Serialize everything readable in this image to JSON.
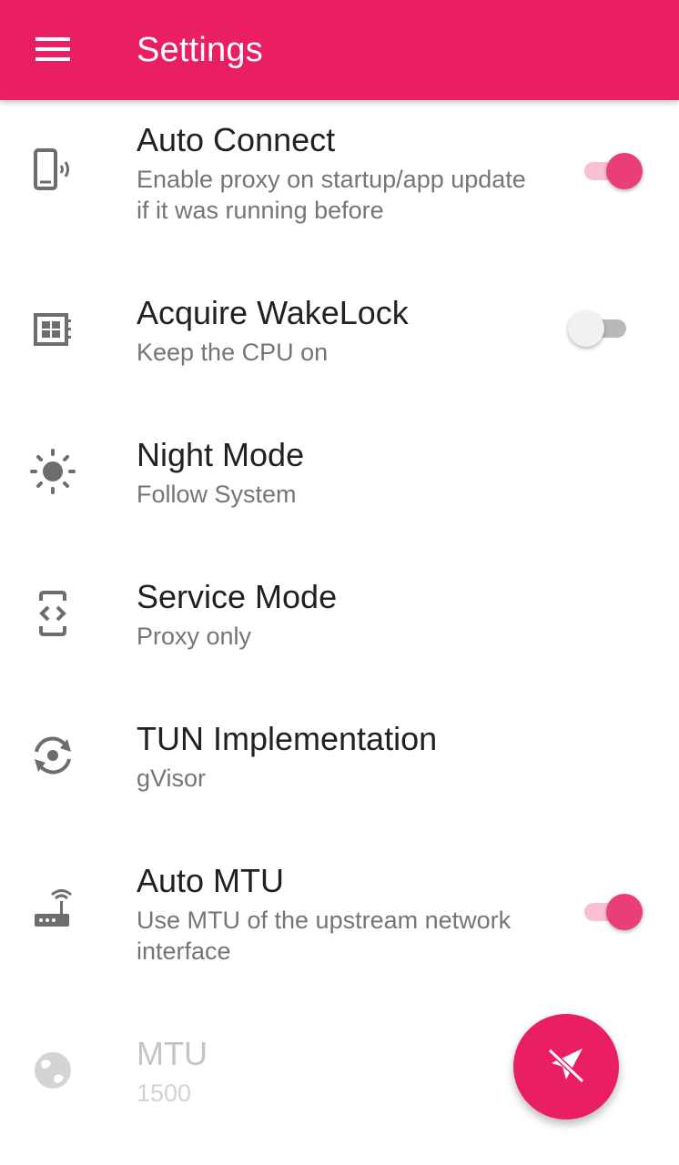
{
  "appbar": {
    "title": "Settings",
    "menu_icon": "menu-icon",
    "color": "#ea1e63"
  },
  "preferences": [
    {
      "title": "Auto Connect",
      "summary": "Enable proxy on startup/app update if it was running before",
      "icon": "phone-ringing-icon",
      "switch": true,
      "checked": true
    },
    {
      "title": "Acquire WakeLock",
      "summary": "Keep the CPU on",
      "icon": "cpu-chip-icon",
      "switch": true,
      "checked": false
    },
    {
      "title": "Night Mode",
      "summary": "Follow System",
      "icon": "brightness-icon"
    },
    {
      "title": "Service Mode",
      "summary": "Proxy only",
      "icon": "developer-mode-icon"
    },
    {
      "title": "TUN Implementation",
      "summary": "gVisor",
      "icon": "camera-switch-icon"
    },
    {
      "title": "Auto MTU",
      "summary": "Use MTU of the upstream network interface",
      "icon": "router-icon",
      "switch": true,
      "checked": true
    },
    {
      "title": "MTU",
      "summary": "1500",
      "icon": "globe-icon",
      "disabled": true
    }
  ],
  "fab": {
    "icon": "paper-plane-off-icon",
    "color": "#ea1e63"
  }
}
